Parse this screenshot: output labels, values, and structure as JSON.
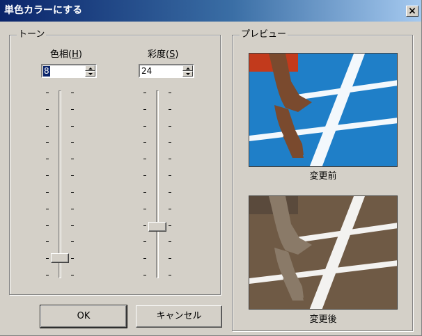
{
  "window": {
    "title": "単色カラーにする",
    "close_glyph": "×"
  },
  "tone": {
    "group_label": "トーン",
    "hue": {
      "label_prefix": "色相(",
      "accesskey": "H",
      "label_suffix": ")",
      "value": "8",
      "slider_level": 0.087
    },
    "saturation": {
      "label_prefix": "彩度(",
      "accesskey": "S",
      "label_suffix": ")",
      "value": "24",
      "slider_level": 0.26
    }
  },
  "preview": {
    "group_label": "プレビュー",
    "before_caption": "変更前",
    "after_caption": "変更後"
  },
  "buttons": {
    "ok": "OK",
    "cancel": "キャンセル"
  },
  "colors": {
    "track_blue": "#1f7fc8",
    "track_sepia": "#6f5a45",
    "skin": "#7a4a2e",
    "skin_sepia": "#8a7a68",
    "shirt_red": "#c23a1c"
  }
}
